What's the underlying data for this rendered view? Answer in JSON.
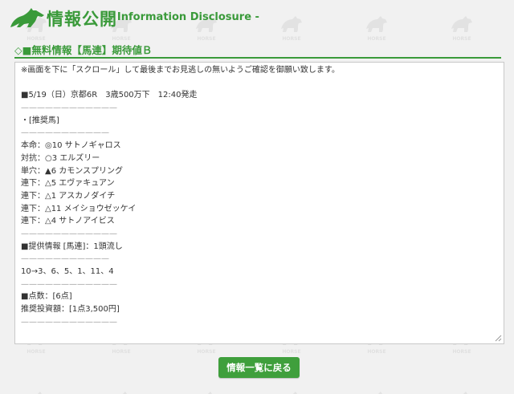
{
  "header": {
    "title": "情報公開",
    "subtitle": "- Information Disclosure -"
  },
  "section": {
    "title": "◇■無料情報【馬連】期待値Ｂ"
  },
  "content": {
    "lines": [
      "※画面を下に「スクロール」して最後までお見逃しの無いようご確認を御願い致します。",
      "",
      "■5/19（日）京都6R　3歳500万下　12:40発走",
      "————————————",
      "・[推奨馬]",
      "———————————",
      "本命：◎10 サトノギャロス",
      "対抗：○3  エルズリー",
      "単穴：▲6  カモンスプリング",
      "連下：△5  エヴァキュアン",
      "連下：△1  アスカノダイチ",
      "連下：△11 メイショウゼッケイ",
      "連下：△4  サトノアイビス",
      "————————————",
      "■提供情報 [馬連]：1頭流し",
      "———————————",
      "10→3、6、5、1、11、4",
      "————————————",
      "■点数：[6点]",
      "推奨投資額：[1点3,500円]",
      "————————————"
    ]
  },
  "button": {
    "back_label": "情報一覧に戻る"
  },
  "background": {
    "watermark_text": "HORSE"
  },
  "colors": {
    "accent": "#3a9a3a",
    "button": "#3f9f3c",
    "page_bg": "#f1f1f1",
    "box_bg": "#ffffff"
  }
}
